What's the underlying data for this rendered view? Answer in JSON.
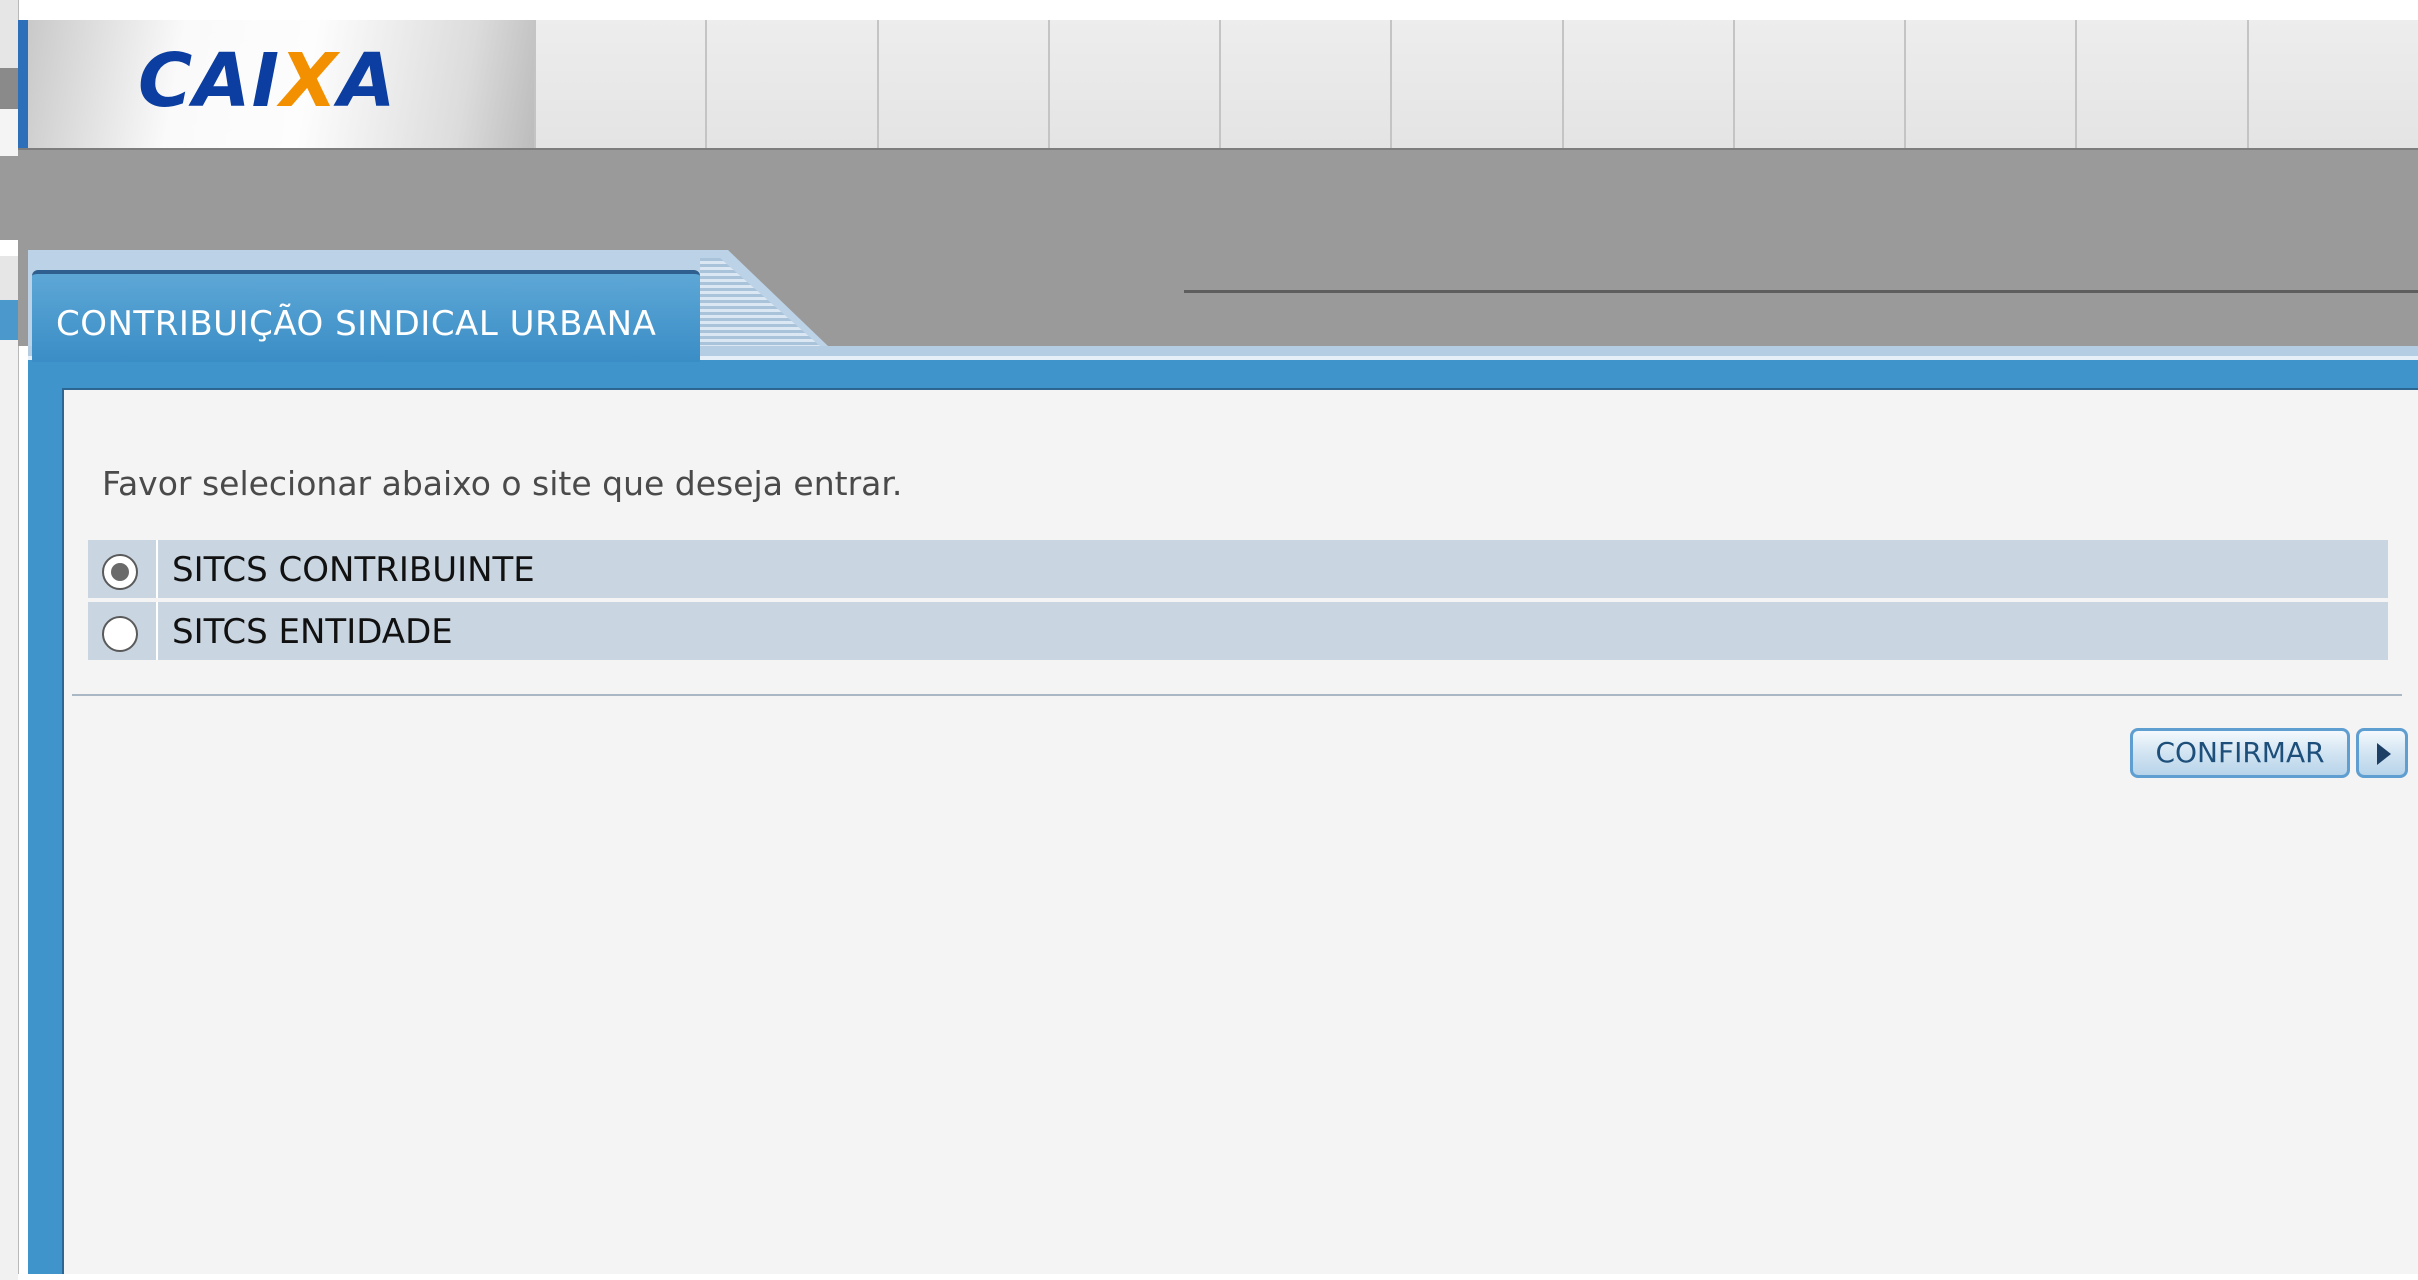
{
  "header": {
    "logo_text_before": "CAI",
    "logo_text_x": "X",
    "logo_text_after": "A",
    "brand_color": "#0b3ea0",
    "logo_accent_color": "#f39000"
  },
  "tab": {
    "title": "CONTRIBUIÇÃO SINDICAL URBANA"
  },
  "form": {
    "instruction": "Favor selecionar abaixo o site que deseja entrar.",
    "options": [
      {
        "label": "SITCS CONTRIBUINTE",
        "selected": true
      },
      {
        "label": "SITCS ENTIDADE",
        "selected": false
      }
    ],
    "confirm_label": "CONFIRMAR",
    "confirm_icon": "play-arrow-icon"
  }
}
